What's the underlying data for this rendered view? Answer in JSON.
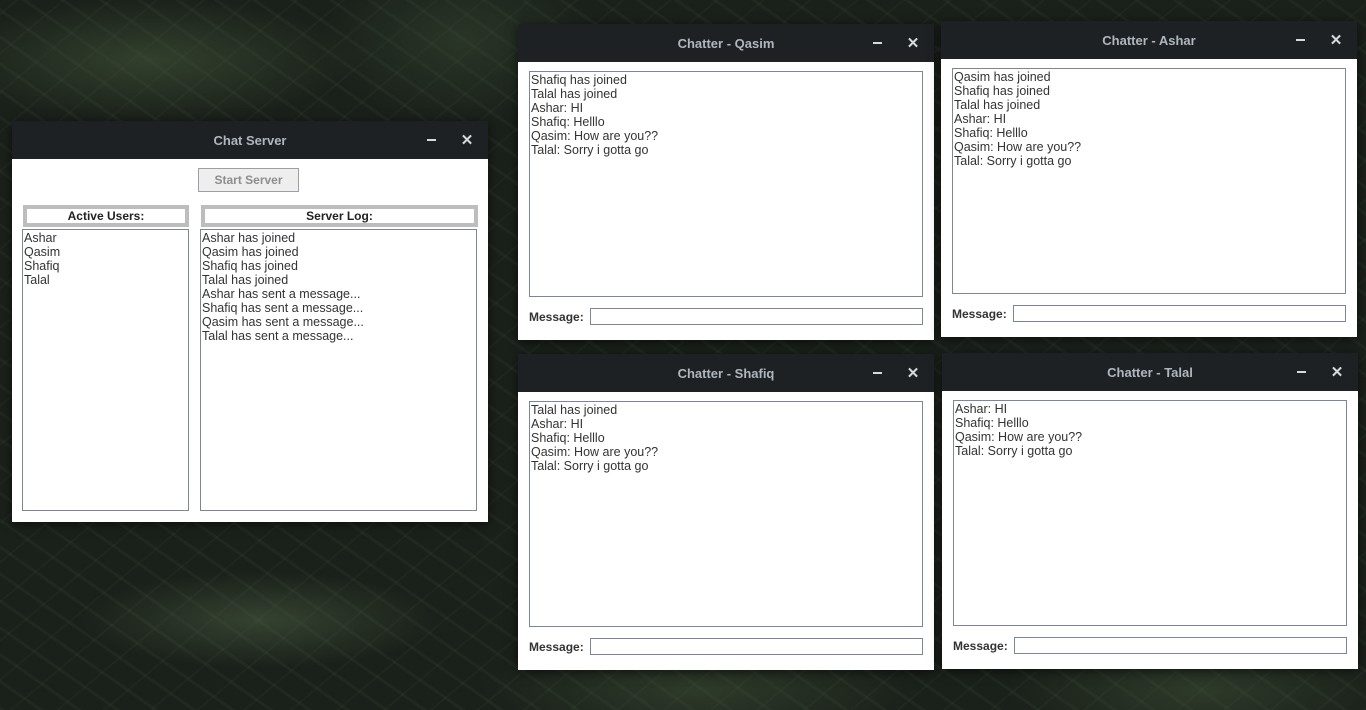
{
  "server": {
    "title": "Chat Server",
    "start_button": "Start Server",
    "active_users_label": "Active Users:",
    "server_log_label": "Server Log:",
    "active_users": [
      "Ashar",
      "Qasim",
      "Shafiq",
      "Talal"
    ],
    "server_log": [
      "Ashar has joined",
      "Qasim has joined",
      "Shafiq has joined",
      "Talal has joined",
      "Ashar has sent a message...",
      "Shafiq has sent a message...",
      "Qasim has sent a message...",
      "Talal has sent a message..."
    ]
  },
  "chatters": [
    {
      "title": "Chatter - Qasim",
      "message_label": "Message:",
      "message_value": "",
      "lines": [
        "Shafiq has joined",
        "Talal has joined",
        "Ashar: HI",
        "Shafiq: Helllo",
        "Qasim: How are you??",
        "Talal: Sorry i gotta go"
      ]
    },
    {
      "title": "Chatter - Ashar",
      "message_label": "Message:",
      "message_value": "",
      "lines": [
        "Qasim has joined",
        "Shafiq has joined",
        "Talal has joined",
        "Ashar: HI",
        "Shafiq: Helllo",
        "Qasim: How are you??",
        "Talal: Sorry i gotta go"
      ]
    },
    {
      "title": "Chatter - Shafiq",
      "message_label": "Message:",
      "message_value": "",
      "lines": [
        "Talal has joined",
        "Ashar: HI",
        "Shafiq: Helllo",
        "Qasim: How are you??",
        "Talal: Sorry i gotta go"
      ]
    },
    {
      "title": "Chatter - Talal",
      "message_label": "Message:",
      "message_value": "",
      "lines": [
        "Ashar: HI",
        "Shafiq: Helllo",
        "Qasim: How are you??",
        "Talal: Sorry i gotta go"
      ]
    }
  ],
  "icons": {
    "minimize": "minimize-icon",
    "close": "close-icon"
  },
  "colors": {
    "titlebar_bg": "#1e2124",
    "titlebar_text": "#aeb7bf",
    "border": "#7d8794"
  }
}
